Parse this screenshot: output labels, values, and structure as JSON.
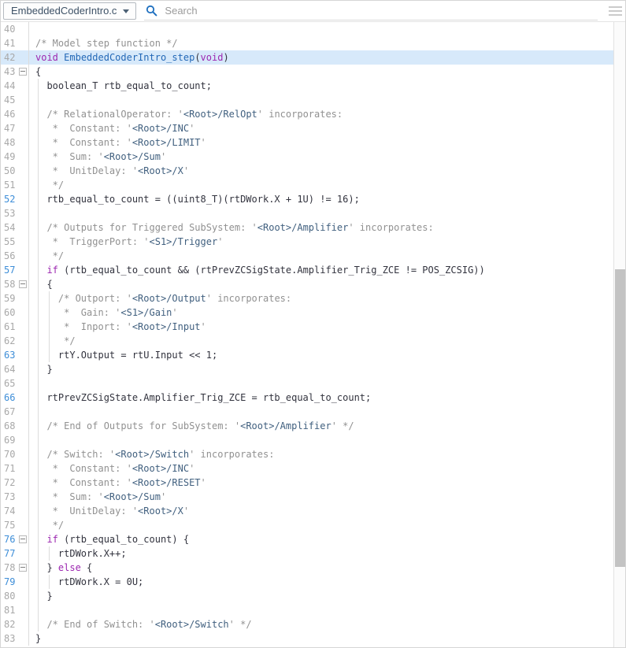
{
  "toolbar": {
    "file_selector": {
      "value": "EmbeddedCoderIntro.c"
    },
    "search": {
      "placeholder": "Search"
    }
  },
  "colors": {
    "file-selector-text": "#3d5166",
    "search-icon": "#1d6fbf",
    "highlight-bg": "#d7e9fa",
    "line-number": "#a8a8a8",
    "line-number-active": "#3e8ed8",
    "code-text": "#32333e",
    "comment": "#919191",
    "link": "#41607f",
    "keyword": "#9c27b0",
    "function-name": "#2368b7"
  },
  "code_view": {
    "language": "c",
    "highlighted_line": 42,
    "lines": [
      {
        "num": 40,
        "blue": false,
        "fold": false,
        "guides": [],
        "segments": []
      },
      {
        "num": 41,
        "blue": false,
        "fold": false,
        "guides": [],
        "segments": [
          {
            "s": "c",
            "t": "/* Model step function */"
          }
        ]
      },
      {
        "num": 42,
        "blue": false,
        "fold": false,
        "guides": [],
        "segments": [
          {
            "s": "k",
            "t": "void"
          },
          {
            "s": "n",
            "t": " "
          },
          {
            "s": "f",
            "t": "EmbeddedCoderIntro_step"
          },
          {
            "s": "n",
            "t": "("
          },
          {
            "s": "k",
            "t": "void"
          },
          {
            "s": "n",
            "t": ")"
          }
        ]
      },
      {
        "num": 43,
        "blue": false,
        "fold": true,
        "guides": [],
        "segments": [
          {
            "s": "n",
            "t": "{"
          }
        ]
      },
      {
        "num": 44,
        "blue": false,
        "fold": false,
        "guides": [
          0
        ],
        "segments": [
          {
            "s": "n",
            "t": "  boolean_T rtb_equal_to_count;"
          }
        ]
      },
      {
        "num": 45,
        "blue": false,
        "fold": false,
        "guides": [
          0
        ],
        "segments": []
      },
      {
        "num": 46,
        "blue": false,
        "fold": false,
        "guides": [
          0
        ],
        "segments": [
          {
            "s": "c",
            "t": "  /* RelationalOperator: '"
          },
          {
            "s": "l",
            "t": "<Root>/RelOpt"
          },
          {
            "s": "c",
            "t": "' incorporates:"
          }
        ]
      },
      {
        "num": 47,
        "blue": false,
        "fold": false,
        "guides": [
          0
        ],
        "segments": [
          {
            "s": "c",
            "t": "   *  Constant: '"
          },
          {
            "s": "l",
            "t": "<Root>/INC"
          },
          {
            "s": "c",
            "t": "'"
          }
        ]
      },
      {
        "num": 48,
        "blue": false,
        "fold": false,
        "guides": [
          0
        ],
        "segments": [
          {
            "s": "c",
            "t": "   *  Constant: '"
          },
          {
            "s": "l",
            "t": "<Root>/LIMIT"
          },
          {
            "s": "c",
            "t": "'"
          }
        ]
      },
      {
        "num": 49,
        "blue": false,
        "fold": false,
        "guides": [
          0
        ],
        "segments": [
          {
            "s": "c",
            "t": "   *  Sum: '"
          },
          {
            "s": "l",
            "t": "<Root>/Sum"
          },
          {
            "s": "c",
            "t": "'"
          }
        ]
      },
      {
        "num": 50,
        "blue": false,
        "fold": false,
        "guides": [
          0
        ],
        "segments": [
          {
            "s": "c",
            "t": "   *  UnitDelay: '"
          },
          {
            "s": "l",
            "t": "<Root>/X"
          },
          {
            "s": "c",
            "t": "'"
          }
        ]
      },
      {
        "num": 51,
        "blue": false,
        "fold": false,
        "guides": [
          0
        ],
        "segments": [
          {
            "s": "c",
            "t": "   */"
          }
        ]
      },
      {
        "num": 52,
        "blue": true,
        "fold": false,
        "guides": [
          0
        ],
        "segments": [
          {
            "s": "n",
            "t": "  rtb_equal_to_count = ((uint8_T)(rtDWork.X + 1U) != 16);"
          }
        ]
      },
      {
        "num": 53,
        "blue": false,
        "fold": false,
        "guides": [
          0
        ],
        "segments": []
      },
      {
        "num": 54,
        "blue": false,
        "fold": false,
        "guides": [
          0
        ],
        "segments": [
          {
            "s": "c",
            "t": "  /* Outputs for Triggered SubSystem: '"
          },
          {
            "s": "l",
            "t": "<Root>/Amplifier"
          },
          {
            "s": "c",
            "t": "' incorporates:"
          }
        ]
      },
      {
        "num": 55,
        "blue": false,
        "fold": false,
        "guides": [
          0
        ],
        "segments": [
          {
            "s": "c",
            "t": "   *  TriggerPort: '"
          },
          {
            "s": "l",
            "t": "<S1>/Trigger"
          },
          {
            "s": "c",
            "t": "'"
          }
        ]
      },
      {
        "num": 56,
        "blue": false,
        "fold": false,
        "guides": [
          0
        ],
        "segments": [
          {
            "s": "c",
            "t": "   */"
          }
        ]
      },
      {
        "num": 57,
        "blue": true,
        "fold": false,
        "guides": [
          0
        ],
        "segments": [
          {
            "s": "n",
            "t": "  "
          },
          {
            "s": "k",
            "t": "if"
          },
          {
            "s": "n",
            "t": " (rtb_equal_to_count && (rtPrevZCSigState.Amplifier_Trig_ZCE != POS_ZCSIG))"
          }
        ]
      },
      {
        "num": 58,
        "blue": false,
        "fold": true,
        "guides": [
          0
        ],
        "segments": [
          {
            "s": "n",
            "t": "  {"
          }
        ]
      },
      {
        "num": 59,
        "blue": false,
        "fold": false,
        "guides": [
          0,
          2
        ],
        "segments": [
          {
            "s": "c",
            "t": "    /* Outport: '"
          },
          {
            "s": "l",
            "t": "<Root>/Output"
          },
          {
            "s": "c",
            "t": "' incorporates:"
          }
        ]
      },
      {
        "num": 60,
        "blue": false,
        "fold": false,
        "guides": [
          0,
          2
        ],
        "segments": [
          {
            "s": "c",
            "t": "     *  Gain: '"
          },
          {
            "s": "l",
            "t": "<S1>/Gain"
          },
          {
            "s": "c",
            "t": "'"
          }
        ]
      },
      {
        "num": 61,
        "blue": false,
        "fold": false,
        "guides": [
          0,
          2
        ],
        "segments": [
          {
            "s": "c",
            "t": "     *  Inport: '"
          },
          {
            "s": "l",
            "t": "<Root>/Input"
          },
          {
            "s": "c",
            "t": "'"
          }
        ]
      },
      {
        "num": 62,
        "blue": false,
        "fold": false,
        "guides": [
          0,
          2
        ],
        "segments": [
          {
            "s": "c",
            "t": "     */"
          }
        ]
      },
      {
        "num": 63,
        "blue": true,
        "fold": false,
        "guides": [
          0,
          2
        ],
        "segments": [
          {
            "s": "n",
            "t": "    rtY.Output = rtU.Input << 1;"
          }
        ]
      },
      {
        "num": 64,
        "blue": false,
        "fold": false,
        "guides": [
          0
        ],
        "segments": [
          {
            "s": "n",
            "t": "  }"
          }
        ]
      },
      {
        "num": 65,
        "blue": false,
        "fold": false,
        "guides": [
          0
        ],
        "segments": []
      },
      {
        "num": 66,
        "blue": true,
        "fold": false,
        "guides": [
          0
        ],
        "segments": [
          {
            "s": "n",
            "t": "  rtPrevZCSigState.Amplifier_Trig_ZCE = rtb_equal_to_count;"
          }
        ]
      },
      {
        "num": 67,
        "blue": false,
        "fold": false,
        "guides": [
          0
        ],
        "segments": []
      },
      {
        "num": 68,
        "blue": false,
        "fold": false,
        "guides": [
          0
        ],
        "segments": [
          {
            "s": "c",
            "t": "  /* End of Outputs for SubSystem: '"
          },
          {
            "s": "l",
            "t": "<Root>/Amplifier"
          },
          {
            "s": "c",
            "t": "' */"
          }
        ]
      },
      {
        "num": 69,
        "blue": false,
        "fold": false,
        "guides": [
          0
        ],
        "segments": []
      },
      {
        "num": 70,
        "blue": false,
        "fold": false,
        "guides": [
          0
        ],
        "segments": [
          {
            "s": "c",
            "t": "  /* Switch: '"
          },
          {
            "s": "l",
            "t": "<Root>/Switch"
          },
          {
            "s": "c",
            "t": "' incorporates:"
          }
        ]
      },
      {
        "num": 71,
        "blue": false,
        "fold": false,
        "guides": [
          0
        ],
        "segments": [
          {
            "s": "c",
            "t": "   *  Constant: '"
          },
          {
            "s": "l",
            "t": "<Root>/INC"
          },
          {
            "s": "c",
            "t": "'"
          }
        ]
      },
      {
        "num": 72,
        "blue": false,
        "fold": false,
        "guides": [
          0
        ],
        "segments": [
          {
            "s": "c",
            "t": "   *  Constant: '"
          },
          {
            "s": "l",
            "t": "<Root>/RESET"
          },
          {
            "s": "c",
            "t": "'"
          }
        ]
      },
      {
        "num": 73,
        "blue": false,
        "fold": false,
        "guides": [
          0
        ],
        "segments": [
          {
            "s": "c",
            "t": "   *  Sum: '"
          },
          {
            "s": "l",
            "t": "<Root>/Sum"
          },
          {
            "s": "c",
            "t": "'"
          }
        ]
      },
      {
        "num": 74,
        "blue": false,
        "fold": false,
        "guides": [
          0
        ],
        "segments": [
          {
            "s": "c",
            "t": "   *  UnitDelay: '"
          },
          {
            "s": "l",
            "t": "<Root>/X"
          },
          {
            "s": "c",
            "t": "'"
          }
        ]
      },
      {
        "num": 75,
        "blue": false,
        "fold": false,
        "guides": [
          0
        ],
        "segments": [
          {
            "s": "c",
            "t": "   */"
          }
        ]
      },
      {
        "num": 76,
        "blue": true,
        "fold": true,
        "guides": [
          0
        ],
        "segments": [
          {
            "s": "n",
            "t": "  "
          },
          {
            "s": "k",
            "t": "if"
          },
          {
            "s": "n",
            "t": " (rtb_equal_to_count) {"
          }
        ]
      },
      {
        "num": 77,
        "blue": true,
        "fold": false,
        "guides": [
          0,
          2
        ],
        "segments": [
          {
            "s": "n",
            "t": "    rtDWork.X++;"
          }
        ]
      },
      {
        "num": 78,
        "blue": false,
        "fold": true,
        "guides": [
          0
        ],
        "segments": [
          {
            "s": "n",
            "t": "  } "
          },
          {
            "s": "k",
            "t": "else"
          },
          {
            "s": "n",
            "t": " {"
          }
        ]
      },
      {
        "num": 79,
        "blue": true,
        "fold": false,
        "guides": [
          0,
          2
        ],
        "segments": [
          {
            "s": "n",
            "t": "    rtDWork.X = 0U;"
          }
        ]
      },
      {
        "num": 80,
        "blue": false,
        "fold": false,
        "guides": [
          0
        ],
        "segments": [
          {
            "s": "n",
            "t": "  }"
          }
        ]
      },
      {
        "num": 81,
        "blue": false,
        "fold": false,
        "guides": [
          0
        ],
        "segments": []
      },
      {
        "num": 82,
        "blue": false,
        "fold": false,
        "guides": [
          0
        ],
        "segments": [
          {
            "s": "c",
            "t": "  /* End of Switch: '"
          },
          {
            "s": "l",
            "t": "<Root>/Switch"
          },
          {
            "s": "c",
            "t": "' */"
          }
        ]
      },
      {
        "num": 83,
        "blue": false,
        "fold": false,
        "guides": [],
        "segments": [
          {
            "s": "n",
            "t": "}"
          }
        ]
      }
    ]
  }
}
